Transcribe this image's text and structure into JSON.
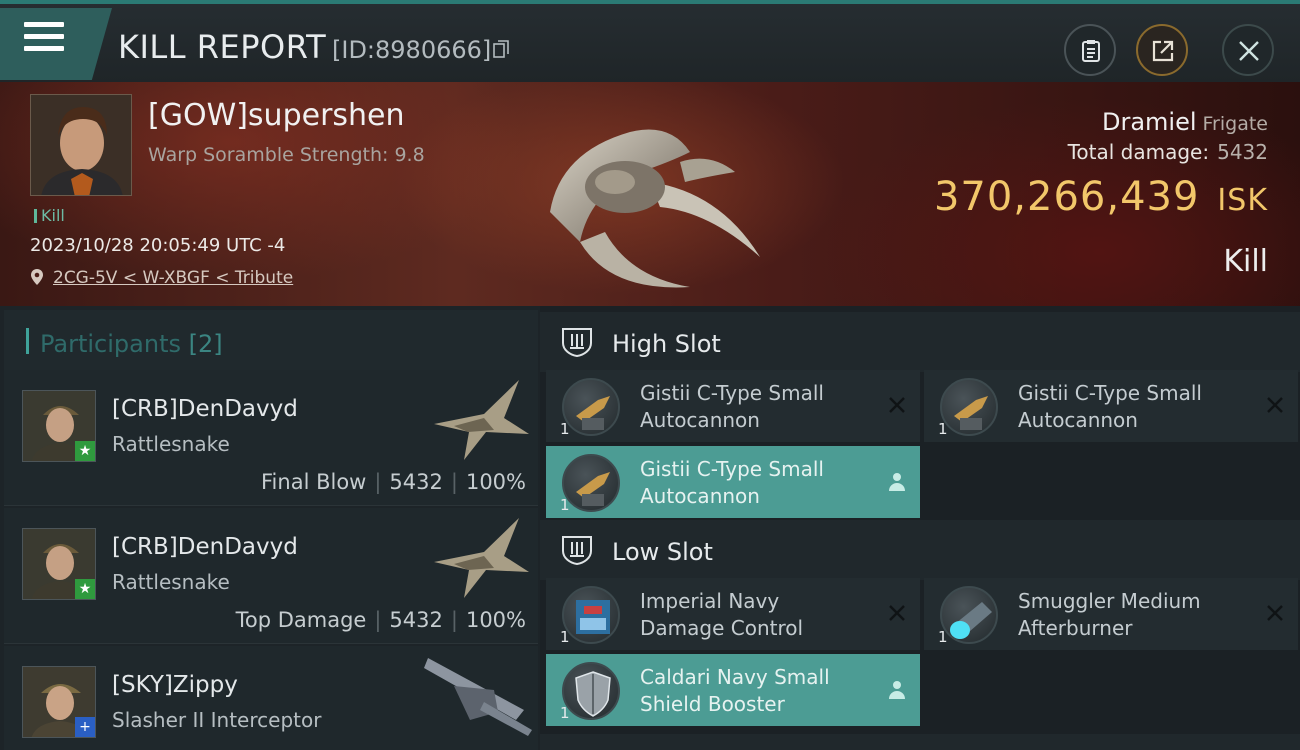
{
  "header": {
    "title": "KILL REPORT",
    "kill_id": "[ID:8980666]"
  },
  "victim": {
    "name": "[GOW]supershen",
    "warp_scramble": "Warp Soramble Strength: 9.8",
    "tag": "Kill",
    "datetime": "2023/10/28 20:05:49 UTC -4",
    "location": "2CG-5V < W-XBGF < Tribute",
    "ship_name": "Dramiel",
    "ship_class": "Frigate",
    "total_damage_label": "Total damage:",
    "total_damage": "5432",
    "isk_value": "370,266,439",
    "isk_unit": "ISK",
    "result": "Kill"
  },
  "participants": {
    "title": "Participants",
    "count": "[2]",
    "rows": [
      {
        "name": "[CRB]DenDavyd",
        "ship": "Rattlesnake",
        "role": "Final Blow",
        "damage": "5432",
        "percent": "100%",
        "badge": "★",
        "badge_color": "#2f9a3e"
      },
      {
        "name": "[CRB]DenDavyd",
        "ship": "Rattlesnake",
        "role": "Top Damage",
        "damage": "5432",
        "percent": "100%",
        "badge": "★",
        "badge_color": "#2f9a3e"
      },
      {
        "name": "[SKY]Zippy",
        "ship": "Slasher II Interceptor",
        "badge": "+",
        "badge_color": "#2a5fc4"
      }
    ]
  },
  "fitting": {
    "high_slot_label": "High Slot",
    "low_slot_label": "Low Slot",
    "high": [
      {
        "line1": "Gistii C-Type Small",
        "line2": "Autocannon",
        "qty": "1",
        "status": "destroyed-icon"
      },
      {
        "line1": "Gistii C-Type Small",
        "line2": "Autocannon",
        "qty": "1",
        "status": "destroyed-icon"
      },
      {
        "line1": "Gistii C-Type Small",
        "line2": "Autocannon",
        "qty": "1",
        "status": "dropped-icon"
      }
    ],
    "low": [
      {
        "line1": "Imperial Navy",
        "line2": "Damage Control",
        "qty": "1",
        "status": "destroyed-icon"
      },
      {
        "line1": "Smuggler Medium",
        "line2": "Afterburner",
        "qty": "1",
        "status": "destroyed-icon"
      },
      {
        "line1": "Caldari Navy Small",
        "line2": "Shield Booster",
        "qty": "1",
        "status": "dropped-icon"
      }
    ]
  },
  "colors": {
    "accent": "#4c9c94",
    "isk": "#f2c76a",
    "header_border": "#2b7a74"
  }
}
